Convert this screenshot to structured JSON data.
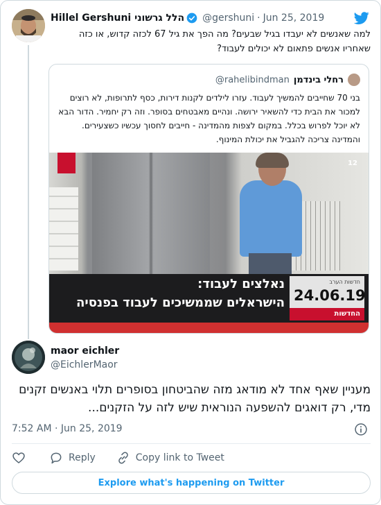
{
  "tweet": {
    "author_name": "Hillel Gershuni הלל גרשוני",
    "author_handle": "@gershuni",
    "separator": "·",
    "date": "Jun 25, 2019",
    "text": "למה שאנשים לא יעבדו בגיל שבעים? מה הפך את גיל 67 לכזה קדוש, או כזה שאחריו אנשים פתאום לא יכולים לעבוד?",
    "icons": {
      "platform": "twitter-bird-icon",
      "verified": "verified-badge-icon"
    },
    "colors": {
      "accent": "#1d9bf0",
      "secondary_text": "#536471",
      "border": "#cfd9de"
    }
  },
  "quoted_tweet": {
    "author_name": "רחלי בינדמן",
    "author_handle": "@rahelibindman",
    "text": "בני 70 שחייבים להמשיך לעבוד. עזרו לילדים לקנות דירות, כסף לתרופות, לא רוצים למכור את הבית כדי להשאיר ירושה. ונהיים מאבטחים בסופר. וזה רק יחמיר. הדור הבא לא יוכל לפרוש בכלל. במקום לצפות מהמדינה - חייבים לחסוך עכשיו כשצעירים. והמדינה צריכה להגביל את יכולת המינוף.",
    "media": {
      "banner_line1": "נאלצים לעבוד:",
      "banner_line2": "הישראלים שממשיכים לעבוד בפנסיה",
      "date": "24.06.19",
      "date_caption": "חדשות הערב",
      "channel": "החדשות",
      "logo": "12"
    }
  },
  "reply": {
    "author_name": "maor eichler",
    "author_handle": "@EichlerMaor",
    "text": "מעניין שאף אחד לא מודאג מזה שהביטחון בסופרים תלוי באנשים זקנים מדי, רק דואגים להשפעה הנוראית שיש לזה על הזקנים...",
    "time": "7:52 AM",
    "separator": "·",
    "date": "Jun 25, 2019"
  },
  "actions": {
    "like_icon": "heart-icon",
    "reply_label": "Reply",
    "copy_link_label": "Copy link to Tweet",
    "explore_label": "Explore what's happening on Twitter",
    "info_icon": "info-icon"
  }
}
